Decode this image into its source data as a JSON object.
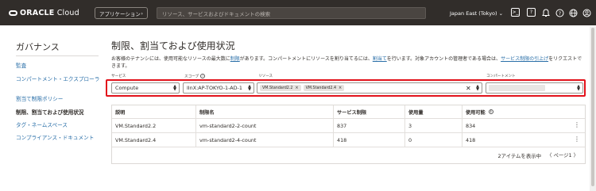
{
  "topbar": {
    "brand_bold": "ORACLE",
    "brand_rest": " Cloud",
    "apps_label": "アプリケーション",
    "apps_chevron": "›",
    "search_placeholder": "リソース、サービスおよびドキュメントの検索",
    "region": "Japan East (Tokyo)",
    "region_chevron": "⌄",
    "icons": [
      "terminal-icon",
      "help-icon",
      "bell-icon",
      "help-circle-icon",
      "globe-icon",
      "user-icon"
    ]
  },
  "nav": {
    "title": "ガバナンス",
    "items": [
      {
        "label": "監査",
        "active": false
      },
      {
        "label": "コンパートメント・エクスプローラ",
        "active": false
      },
      {
        "label": "割当て制限ポリシー",
        "active": false
      },
      {
        "label": "制限、割当ておよび使用状況",
        "active": true
      },
      {
        "label": "タグ・ネームスペース",
        "active": false
      },
      {
        "label": "コンプライアンス・ドキュメント",
        "active": false
      }
    ]
  },
  "main": {
    "title": "制限、割当ておよび使用状況",
    "desc_1": "お客様のテナンシには、使用可能なリソースの最大数に",
    "desc_link_1": "制限",
    "desc_2": "があります。コンパートメントにリソースを割り当てるには、",
    "desc_link_2": "割当て",
    "desc_3": "を行います。対象アカウントの管理者である場合は、",
    "desc_link_3": "サービス制限の引上げ",
    "desc_4": "をリクエストできます。"
  },
  "filters": {
    "service_label": "サービス",
    "scope_label": "スコープ",
    "resource_label": "リソース",
    "compartment_label": "コンパートメント",
    "service_value": "Compute",
    "scope_value": "lInX:AP-TOKYO-1-AD-1",
    "resource_chips": [
      "VM.Standard2.2",
      "VM.Standard2.4"
    ],
    "chip_remove": "×",
    "clear": "✕",
    "info": "i"
  },
  "table": {
    "columns": [
      "説明",
      "制限名",
      "サービス制限",
      "使用量",
      "使用可能"
    ],
    "available_info": "i",
    "rows": [
      {
        "desc": "VM.Standard2.2",
        "name": "vm-standard2-2-count",
        "limit": "837",
        "used": "3",
        "available": "834"
      },
      {
        "desc": "VM.Standard2.4",
        "name": "vm-standard2-4-count",
        "limit": "418",
        "used": "0",
        "available": "418"
      }
    ],
    "kebab": "⋮",
    "count": "2アイテムを表示中",
    "pager": "〈 ページ1 〉"
  }
}
